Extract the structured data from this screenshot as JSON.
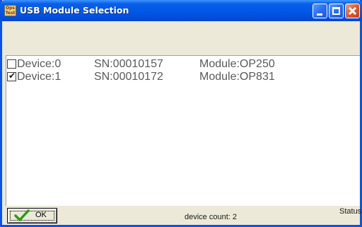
{
  "window": {
    "title": "USB Module Selection",
    "icon_text": "Ops Test"
  },
  "devices": [
    {
      "checked": false,
      "device": "Device:0",
      "sn": "SN:00010157",
      "module": "Module:OP250"
    },
    {
      "checked": true,
      "device": "Device:1",
      "sn": "SN:00010172",
      "module": "Module:OP831"
    }
  ],
  "footer": {
    "ok_label": "OK",
    "device_count": "device count: 2",
    "status_label": "Status"
  },
  "colors": {
    "titlebar": "#0058e6",
    "list_text": "#5a5a5a",
    "ok_check": "#2e9a1a"
  },
  "icons": {
    "app": "ops-test-app-icon",
    "minimize": "minimize-icon",
    "maximize": "maximize-icon",
    "close": "close-icon",
    "ok": "green-checkmark-icon"
  }
}
